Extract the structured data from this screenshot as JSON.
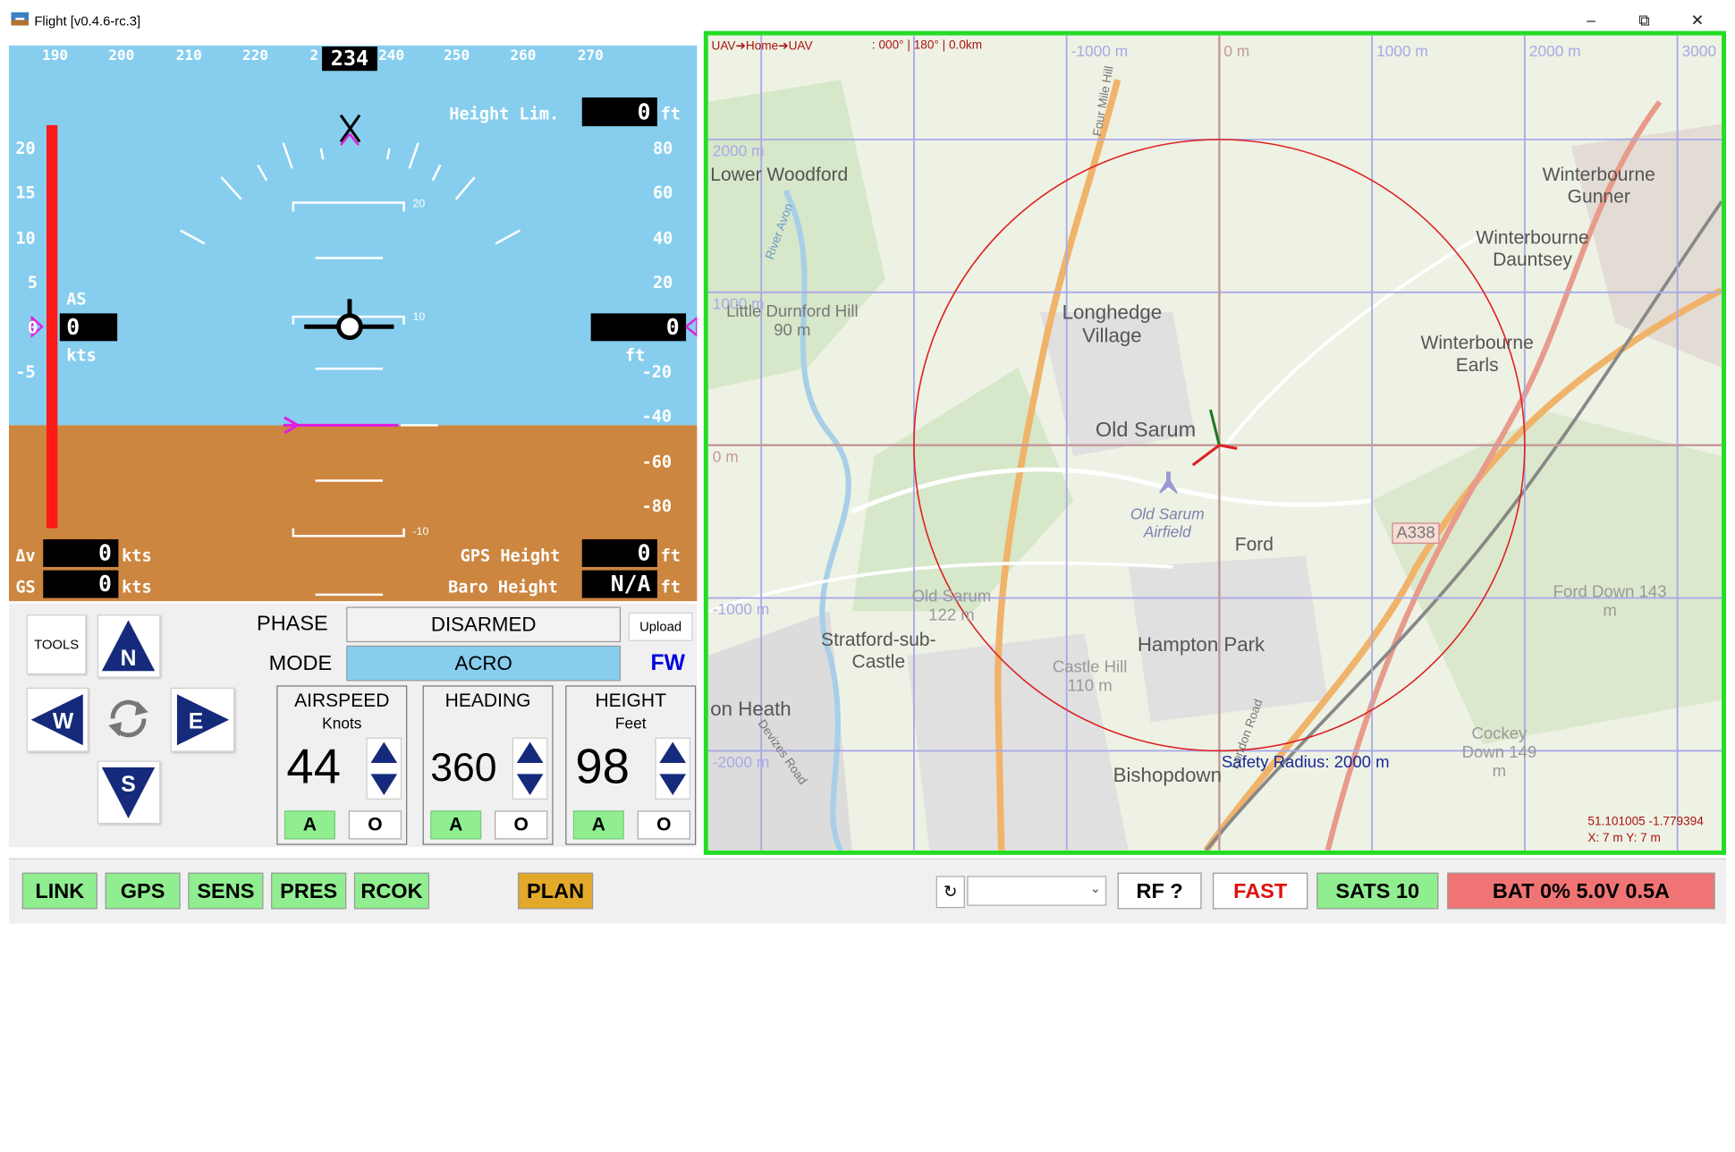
{
  "window": {
    "title": "Flight [v0.4.6-rc.3]",
    "minimize_icon": "minimize-icon",
    "restore_icon": "restore-icon",
    "close_icon": "close-icon"
  },
  "pfd": {
    "heading_scale": [
      "190",
      "200",
      "210",
      "220",
      "2",
      "240",
      "250",
      "260",
      "270"
    ],
    "heading_value": "234",
    "height_limit_label": "Height Lim.",
    "height_limit_value": "0",
    "height_limit_unit": "ft",
    "speed_scale": [
      "20",
      "15",
      "10",
      "5",
      "0",
      "-5"
    ],
    "altitude_scale": [
      "80",
      "60",
      "40",
      "20",
      "-20",
      "-40",
      "-60",
      "-80"
    ],
    "as_label": "AS",
    "as_value": "0",
    "as_unit": "kts",
    "alt_value": "0",
    "alt_unit": "ft",
    "pitch_labels": [
      "20",
      "10",
      "-10"
    ],
    "dv_label": "Δv",
    "dv_value": "0",
    "dv_unit": "kts",
    "gs_label": "GS",
    "gs_value": "0",
    "gs_unit": "kts",
    "gps_height_label": "GPS Height",
    "gps_height_value": "0",
    "gps_height_unit": "ft",
    "baro_height_label": "Baro Height",
    "baro_height_value": "N/A",
    "baro_height_unit": "ft"
  },
  "controls": {
    "tools_label": "TOOLS",
    "nav": {
      "n": "N",
      "w": "W",
      "e": "E",
      "s": "S"
    },
    "phase_label": "PHASE",
    "phase_value": "DISARMED",
    "upload_label": "Upload",
    "mode_label": "MODE",
    "mode_value": "ACRO",
    "mode_type": "FW",
    "groups": [
      {
        "title": "AIRSPEED",
        "unit": "Knots",
        "value": "44",
        "a": "A",
        "o": "O"
      },
      {
        "title": "HEADING",
        "unit": "",
        "value": "360",
        "a": "A",
        "o": "O"
      },
      {
        "title": "HEIGHT",
        "unit": "Feet",
        "value": "98",
        "a": "A",
        "o": "O"
      }
    ]
  },
  "map": {
    "info_bar": "UAV➔Home➔UAV",
    "info_values": ": 000° | 180° | 0.0km",
    "grid_labels_top": [
      "-1000 m",
      "0 m",
      "1000 m",
      "2000 m",
      "3000"
    ],
    "grid_labels_left": [
      "2000 m",
      "1000 m",
      "0 m",
      "-1000 m",
      "-2000 m"
    ],
    "places": [
      "Lower Woodford",
      "Winterbourne Gunner",
      "Winterbourne Dauntsey",
      "Little Durnford Hill 90 m",
      "Longhedge Village",
      "Winterbourne Earls",
      "Old Sarum",
      "Old Sarum Airfield",
      "Ford",
      "A338",
      "Old Sarum 122 m",
      "Stratford-sub-Castle",
      "Hampton Park",
      "Castle Hill 110 m",
      "Ford Down 143 m",
      "on Heath",
      "Bishopdown",
      "Cockey Down 149 m",
      "Four Mile Hill",
      "River Avon",
      "Devizes Road",
      "London Road"
    ],
    "safety_radius": "Safety Radius: 2000 m",
    "coords": "51.101005 -1.779394",
    "xy": "X: 7 m Y: 7 m"
  },
  "status": {
    "link": "LINK",
    "gps": "GPS",
    "sens": "SENS",
    "pres": "PRES",
    "rcok": "RCOK",
    "plan": "PLAN",
    "refresh_icon": "refresh-icon",
    "dropdown_value": "",
    "rf": "RF ?",
    "fast": "FAST",
    "sats": "SATS 10",
    "bat": "BAT 0% 5.0V 0.5A"
  },
  "colors": {
    "sky": "#87ceee",
    "ground": "#cc8640",
    "speed_bar": "#ff1a1a",
    "magenta": "#e020e0",
    "green_ok": "#90ee90",
    "plan": "#e2a92a",
    "bat_bg": "#f07474",
    "frame": "#22dd22",
    "mode_bg": "#87ceee"
  }
}
